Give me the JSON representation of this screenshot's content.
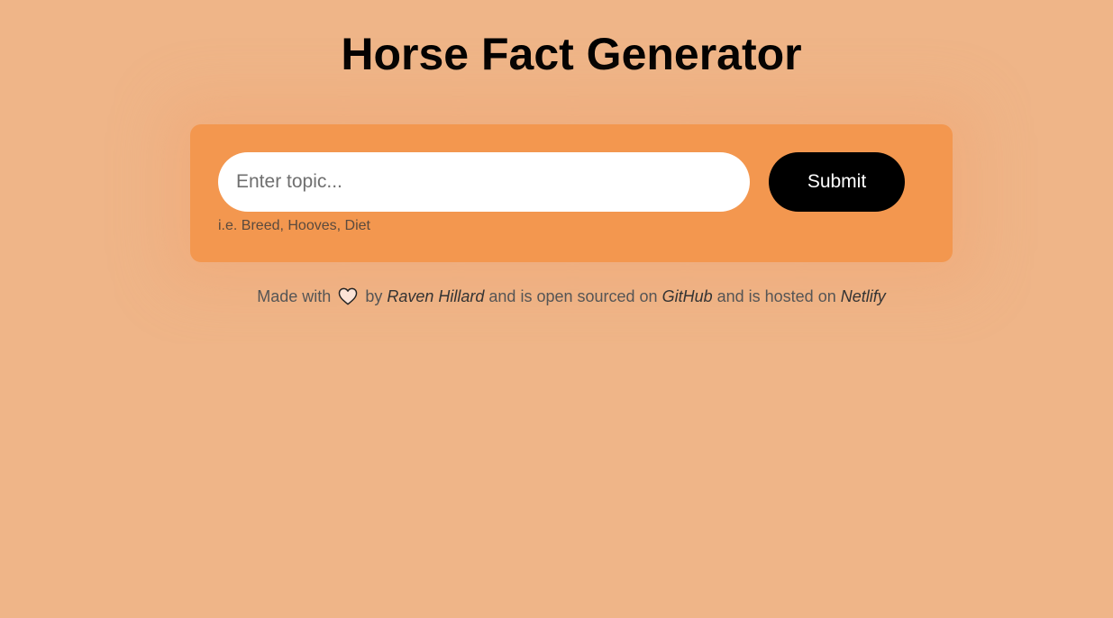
{
  "header": {
    "title": "Horse Fact Generator"
  },
  "form": {
    "input_placeholder": "Enter topic...",
    "input_value": "",
    "submit_label": "Submit",
    "hint": "i.e. Breed, Hooves, Diet"
  },
  "footer": {
    "made_with": "Made with",
    "heart_icon": "heart-icon",
    "by": "by",
    "author": "Raven Hillard",
    "open_sourced": "and is open sourced on",
    "github": "GitHub",
    "hosted": "and is hosted on",
    "netlify": "Netlify"
  },
  "colors": {
    "background": "#efb588",
    "card": "#f3974f",
    "button": "#000000",
    "button_text": "#ffffff"
  }
}
